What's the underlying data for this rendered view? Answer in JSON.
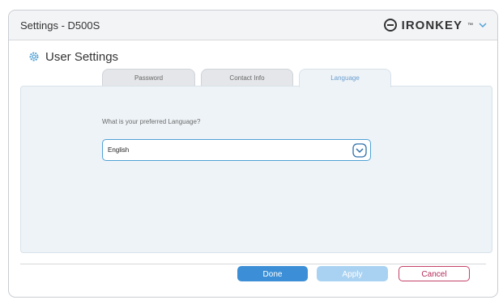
{
  "window": {
    "title": "Settings - D500S"
  },
  "brand": {
    "name": "IRONKEY",
    "tm": "™",
    "menu_icon": "chevron-down-icon"
  },
  "section": {
    "icon": "gear-icon",
    "title": "User Settings"
  },
  "tabs": [
    {
      "label": "Password",
      "active": false
    },
    {
      "label": "Contact Info",
      "active": false
    },
    {
      "label": "Language",
      "active": true
    }
  ],
  "language": {
    "question": "What is your preferred Language?",
    "selected": "English",
    "dropdown_icon": "chevron-down-circle-icon"
  },
  "buttons": {
    "done": "Done",
    "apply": "Apply",
    "cancel": "Cancel"
  },
  "colors": {
    "accent": "#3c8fd6",
    "panel": "#eef3f7",
    "cancel": "#b42a56"
  }
}
